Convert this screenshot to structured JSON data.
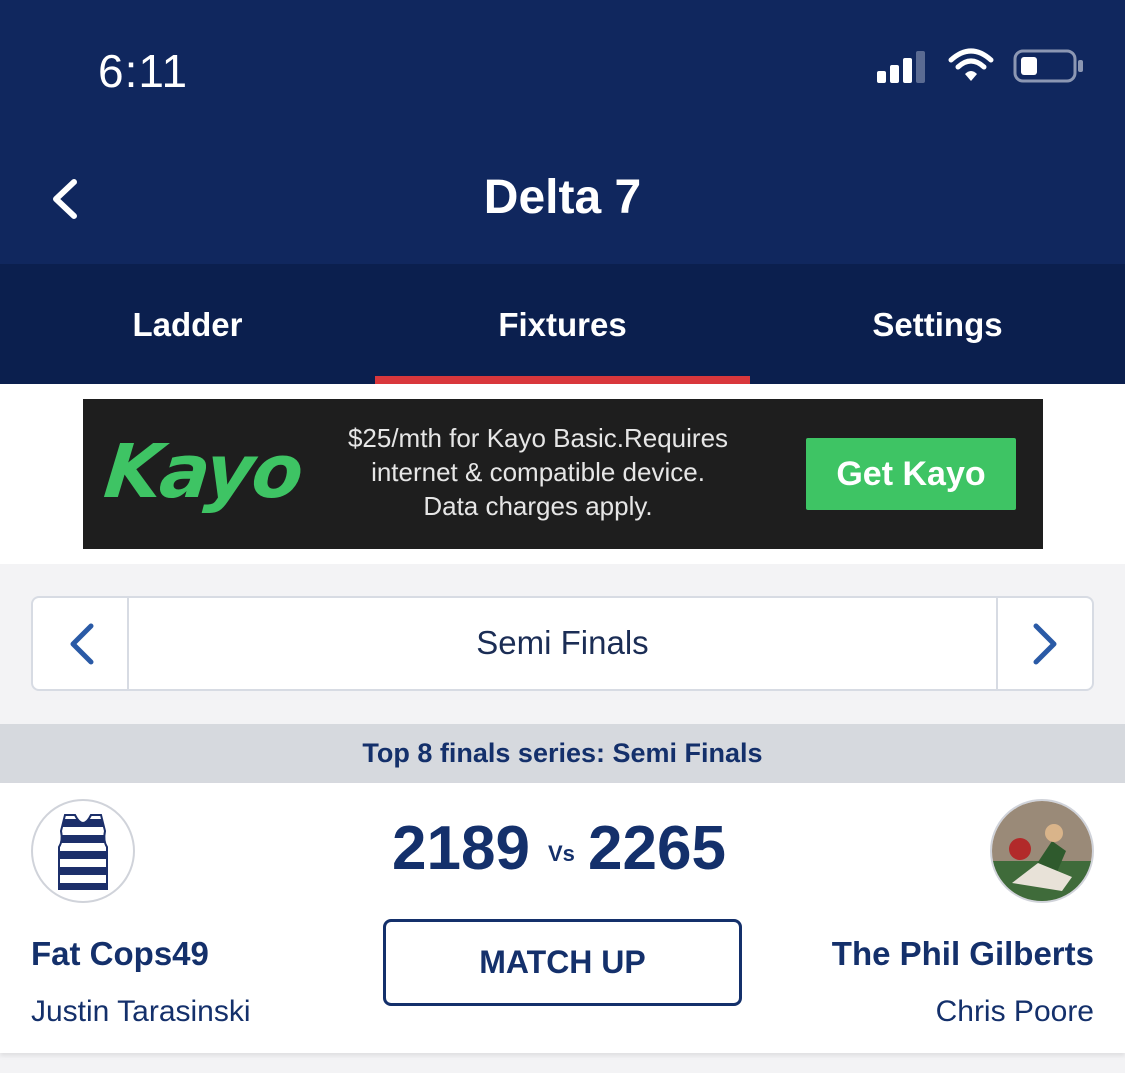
{
  "status_bar": {
    "time": "6:11",
    "signal_icon": "cellular-signal-icon",
    "wifi_icon": "wifi-icon",
    "battery_icon": "battery-icon"
  },
  "header": {
    "title": "Delta 7",
    "back_icon": "chevron-left-icon"
  },
  "tabs": [
    {
      "label": "Ladder",
      "active": false
    },
    {
      "label": "Fixtures",
      "active": true
    },
    {
      "label": "Settings",
      "active": false
    }
  ],
  "ad": {
    "logo": "Kayo",
    "line1": "$25/mth for Kayo Basic.Requires",
    "line2": "internet & compatible device.",
    "line3": "Data charges apply.",
    "cta": "Get Kayo"
  },
  "round_selector": {
    "label": "Semi Finals",
    "prev_icon": "chevron-left-icon",
    "next_icon": "chevron-right-icon"
  },
  "series_title": "Top 8 finals series: Semi Finals",
  "match": {
    "home": {
      "team": "Fat Cops49",
      "coach": "Justin Tarasinski",
      "score": "2189"
    },
    "vs_label": "Vs",
    "away": {
      "team": "The Phil Gilberts",
      "coach": "Chris Poore",
      "score": "2265"
    },
    "button_label": "MATCH UP"
  },
  "colors": {
    "header_bg": "#10275e",
    "tabs_bg": "#0b1f4e",
    "active_tab_indicator": "#d9373c",
    "primary_text": "#14306b",
    "ad_green": "#3ec464"
  }
}
